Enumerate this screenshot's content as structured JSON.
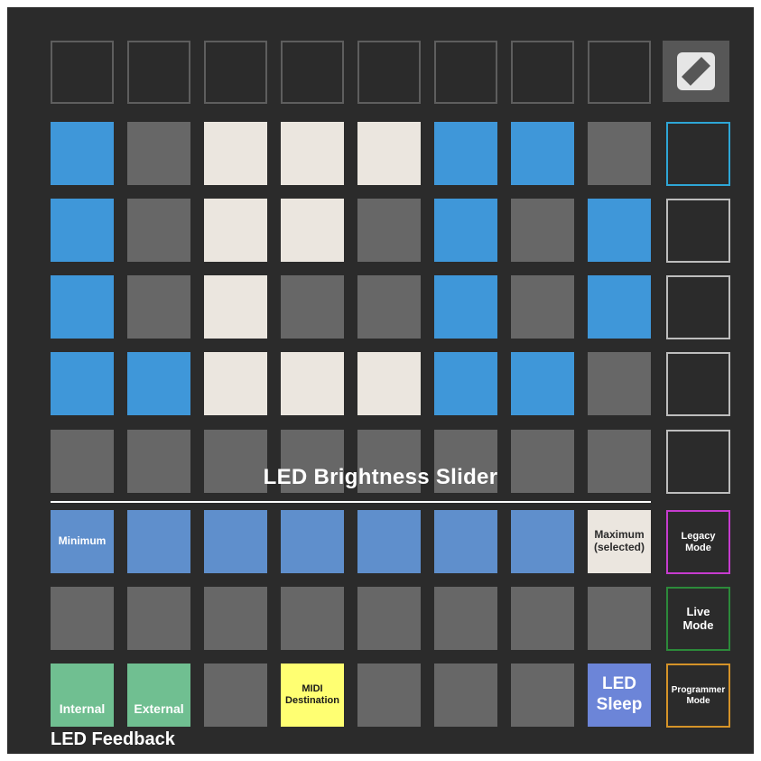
{
  "top_row": {
    "logo_icon": "novation-logo-icon"
  },
  "grid": {
    "rows": [
      [
        "blue",
        "grey",
        "cream",
        "cream",
        "cream",
        "blue",
        "blue",
        "grey"
      ],
      [
        "blue",
        "grey",
        "cream",
        "cream",
        "grey",
        "blue",
        "grey",
        "blue"
      ],
      [
        "blue",
        "grey",
        "cream",
        "grey",
        "grey",
        "blue",
        "grey",
        "blue"
      ],
      [
        "blue",
        "blue",
        "cream",
        "cream",
        "cream",
        "blue",
        "blue",
        "grey"
      ],
      [
        "grey",
        "grey",
        "grey",
        "grey",
        "grey",
        "grey",
        "grey",
        "grey"
      ]
    ]
  },
  "brightness": {
    "title": "LED Brightness Slider",
    "minimum_label": "Minimum",
    "maximum_label_line1": "Maximum",
    "maximum_label_line2": "(selected)"
  },
  "bottom_row": {
    "internal_label": "Internal",
    "external_label": "External",
    "midi_line1": "MIDI",
    "midi_line2": "Destination",
    "sleep_line1": "LED",
    "sleep_line2": "Sleep"
  },
  "side_buttons": {
    "legacy_line1": "Legacy",
    "legacy_line2": "Mode",
    "live_line1": "Live",
    "live_line2": "Mode",
    "programmer_line1": "Programmer",
    "programmer_line2": "Mode"
  },
  "feedback_title": "LED Feedback",
  "colors": {
    "blue": "#3f97d9",
    "grey": "#676767",
    "cream": "#ebe6df",
    "slider": "#5f8fcc",
    "green": "#70bf91",
    "yellow": "#ffff72",
    "sleep": "#6c85d8",
    "legacy_border": "#c63ccf",
    "live_border": "#2c8a3a",
    "programmer_border": "#d59328",
    "first_side_border": "#2ea6d6"
  }
}
